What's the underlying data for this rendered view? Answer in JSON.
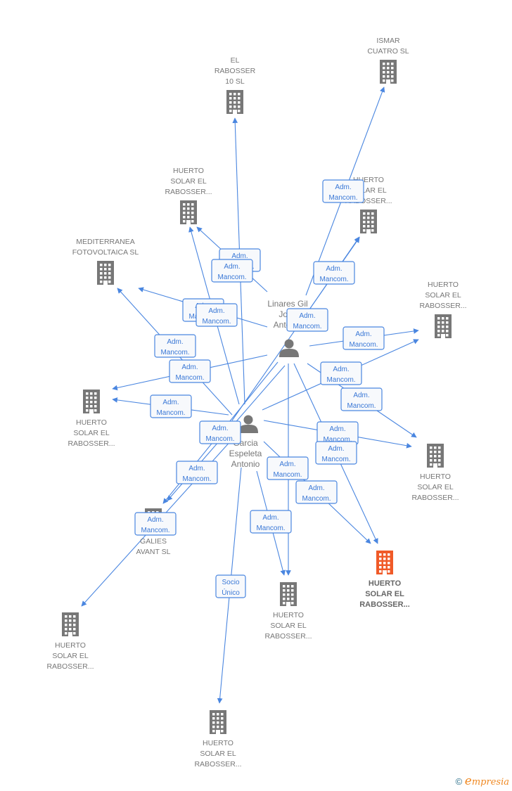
{
  "people": [
    {
      "id": "linares",
      "lines": [
        "Linares Gil",
        "Jose",
        "Antonio"
      ]
    },
    {
      "id": "garcia",
      "lines": [
        "Garcia",
        "Espeleta",
        "Antonio"
      ]
    }
  ],
  "companies": [
    {
      "id": "c1",
      "lines": [
        "EL",
        "RABOSSER",
        "10  SL"
      ]
    },
    {
      "id": "c2",
      "lines": [
        "ISMAR",
        "CUATRO SL"
      ]
    },
    {
      "id": "c3",
      "lines": [
        "HUERTO",
        "SOLAR EL",
        "RABOSSER..."
      ]
    },
    {
      "id": "c4",
      "lines": [
        "HUERTO",
        "SOLAR EL",
        "RABOSSER..."
      ]
    },
    {
      "id": "c5",
      "lines": [
        "MEDITERRANEA",
        "FOTOVOLTAICA SL"
      ]
    },
    {
      "id": "c6",
      "lines": [
        "HUERTO",
        "SOLAR EL",
        "RABOSSER..."
      ]
    },
    {
      "id": "c7",
      "lines": [
        "HUERTO",
        "SOLAR EL",
        "RABOSSER..."
      ]
    },
    {
      "id": "c8",
      "lines": [
        "HUERTO",
        "SOLAR EL",
        "RABOSSER..."
      ]
    },
    {
      "id": "c9",
      "lines": [
        "GALIES",
        "AVANT SL"
      ]
    },
    {
      "id": "c10",
      "lines": [
        "HUERTO",
        "SOLAR EL",
        "RABOSSER..."
      ],
      "highlighted": true
    },
    {
      "id": "c11",
      "lines": [
        "HUERTO",
        "SOLAR EL",
        "RABOSSER..."
      ]
    },
    {
      "id": "c12",
      "lines": [
        "HUERTO",
        "SOLAR EL",
        "RABOSSER..."
      ]
    },
    {
      "id": "c13",
      "lines": [
        "HUERTO",
        "SOLAR EL",
        "RABOSSER..."
      ]
    }
  ],
  "relations": {
    "adm": [
      "Adm.",
      "Mancom."
    ],
    "socio": [
      "Socio",
      "Único"
    ]
  },
  "colors": {
    "edge": "#4a86e0",
    "node": "#777777",
    "highlight": "#f05a28"
  },
  "footer": {
    "copyright": "©",
    "brand_initial": "e",
    "brand_rest": "mpresia"
  }
}
